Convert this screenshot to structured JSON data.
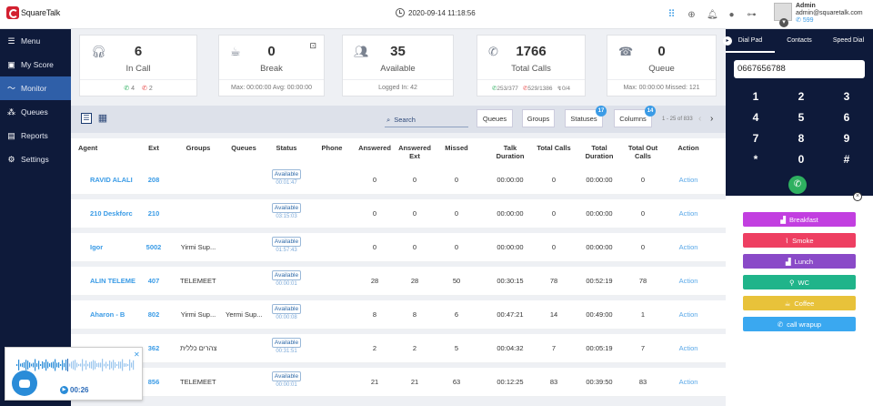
{
  "app": {
    "brand": "SquareTalk",
    "datetime": "2020-09-14 11:18:56"
  },
  "user": {
    "name": "Admin",
    "email": "admin@squaretalk.com",
    "ext": "599"
  },
  "sidebar": {
    "items": [
      {
        "label": "Menu",
        "icon": "hamburger-icon"
      },
      {
        "label": "My Score",
        "icon": "person-icon"
      },
      {
        "label": "Monitor",
        "icon": "pulse-icon",
        "active": true
      },
      {
        "label": "Queues",
        "icon": "people-icon"
      },
      {
        "label": "Reports",
        "icon": "report-icon"
      },
      {
        "label": "Settings",
        "icon": "gear-icon"
      }
    ]
  },
  "cards": {
    "incall": {
      "count": "6",
      "label": "In Call",
      "in": "4",
      "out": "2"
    },
    "break": {
      "count": "0",
      "label": "Break",
      "footer": "Max: 00:00:00  Avg: 00:00:00"
    },
    "available": {
      "count": "35",
      "label": "Available",
      "footer": "Logged In: 42"
    },
    "total": {
      "count": "1766",
      "label": "Total Calls",
      "in": "253",
      "in_total": "377",
      "out": "529",
      "out_total": "1386",
      "missed": "0",
      "missed_total": "4"
    },
    "queue": {
      "count": "0",
      "label": "Queue",
      "footer": "Max: 00:00:00  Missed: 121"
    }
  },
  "toolbar": {
    "search_placeholder": "Search",
    "queues": "Queues",
    "groups": "Groups",
    "statuses": "Statuses",
    "statuses_badge": "17",
    "columns": "Columns",
    "columns_badge": "14",
    "pager": "1 - 25 of 833"
  },
  "table": {
    "headers": [
      "Agent",
      "Ext",
      "Groups",
      "Queues",
      "Status",
      "Phone",
      "Answered",
      "Answered Ext",
      "Missed",
      "Talk Duration",
      "Total Calls",
      "Total Duration",
      "Total Out Calls",
      "Action"
    ],
    "rows": [
      {
        "agent": "RAVID ALALI",
        "ext": "208",
        "groups": "",
        "queues": "",
        "status": "Available",
        "time": "00:01:47",
        "phone": "",
        "answered": "0",
        "answered_ext": "0",
        "missed": "0",
        "talk": "00:00:00",
        "total_calls": "0",
        "total_dur": "00:00:00",
        "out": "0",
        "action": "Action"
      },
      {
        "agent": "210 Deskforc",
        "ext": "210",
        "groups": "",
        "queues": "",
        "status": "Available",
        "time": "03:15:03",
        "phone": "",
        "answered": "0",
        "answered_ext": "0",
        "missed": "0",
        "talk": "00:00:00",
        "total_calls": "0",
        "total_dur": "00:00:00",
        "out": "0",
        "action": "Action"
      },
      {
        "agent": "Igor",
        "ext": "5002",
        "groups": "Yirmi Sup...",
        "queues": "",
        "status": "Available",
        "time": "01:57:43",
        "phone": "",
        "answered": "0",
        "answered_ext": "0",
        "missed": "0",
        "talk": "00:00:00",
        "total_calls": "0",
        "total_dur": "00:00:00",
        "out": "0",
        "action": "Action"
      },
      {
        "agent": "ALIN TELEME",
        "ext": "407",
        "groups": "TELEMEETI...",
        "queues": "",
        "status": "Available",
        "time": "00:00:01",
        "phone": "",
        "answered": "28",
        "answered_ext": "28",
        "missed": "50",
        "talk": "00:30:15",
        "total_calls": "78",
        "total_dur": "00:52:19",
        "out": "78",
        "action": "Action"
      },
      {
        "agent": "Aharon - B",
        "ext": "802",
        "groups": "Yirmi Sup...",
        "queues": "Yermi Sup...",
        "status": "Available",
        "time": "00:00:08",
        "phone": "",
        "answered": "8",
        "answered_ext": "8",
        "missed": "6",
        "talk": "00:47:21",
        "total_calls": "14",
        "total_dur": "00:49:00",
        "out": "1",
        "action": "Action"
      },
      {
        "agent": "",
        "ext": "362",
        "groups": "צהרים כללית",
        "queues": "",
        "status": "Available",
        "time": "00:31:51",
        "phone": "",
        "answered": "2",
        "answered_ext": "2",
        "missed": "5",
        "talk": "00:04:32",
        "total_calls": "7",
        "total_dur": "00:05:19",
        "out": "7",
        "action": "Action"
      },
      {
        "agent": "",
        "ext": "856",
        "groups": "TELEMEETI...",
        "queues": "",
        "status": "Available",
        "time": "00:00:01",
        "phone": "",
        "answered": "21",
        "answered_ext": "21",
        "missed": "63",
        "talk": "00:12:25",
        "total_calls": "83",
        "total_dur": "00:39:50",
        "out": "83",
        "action": "Action"
      }
    ]
  },
  "dialer": {
    "tabs": [
      "Dial Pad",
      "Contacts",
      "Speed Dial"
    ],
    "number": "0667656788",
    "keys": [
      "1",
      "2",
      "3",
      "4",
      "5",
      "6",
      "7",
      "8",
      "9",
      "*",
      "0",
      "#"
    ]
  },
  "breaks": [
    {
      "label": "Breakfast",
      "color": "#c23fe0",
      "icon": "chart-icon"
    },
    {
      "label": "Smoke",
      "color": "#ee3f62",
      "icon": "cigarette-icon"
    },
    {
      "label": "Lunch",
      "color": "#8a4ac8",
      "icon": "chart-icon"
    },
    {
      "label": "WC",
      "color": "#20b48a",
      "icon": "toilet-icon"
    },
    {
      "label": "Coffee",
      "color": "#e8c23a",
      "icon": "cup-icon"
    },
    {
      "label": "call wrapup",
      "color": "#3aa8f0",
      "icon": "phone-icon"
    }
  ],
  "player": {
    "time": "00:26"
  }
}
